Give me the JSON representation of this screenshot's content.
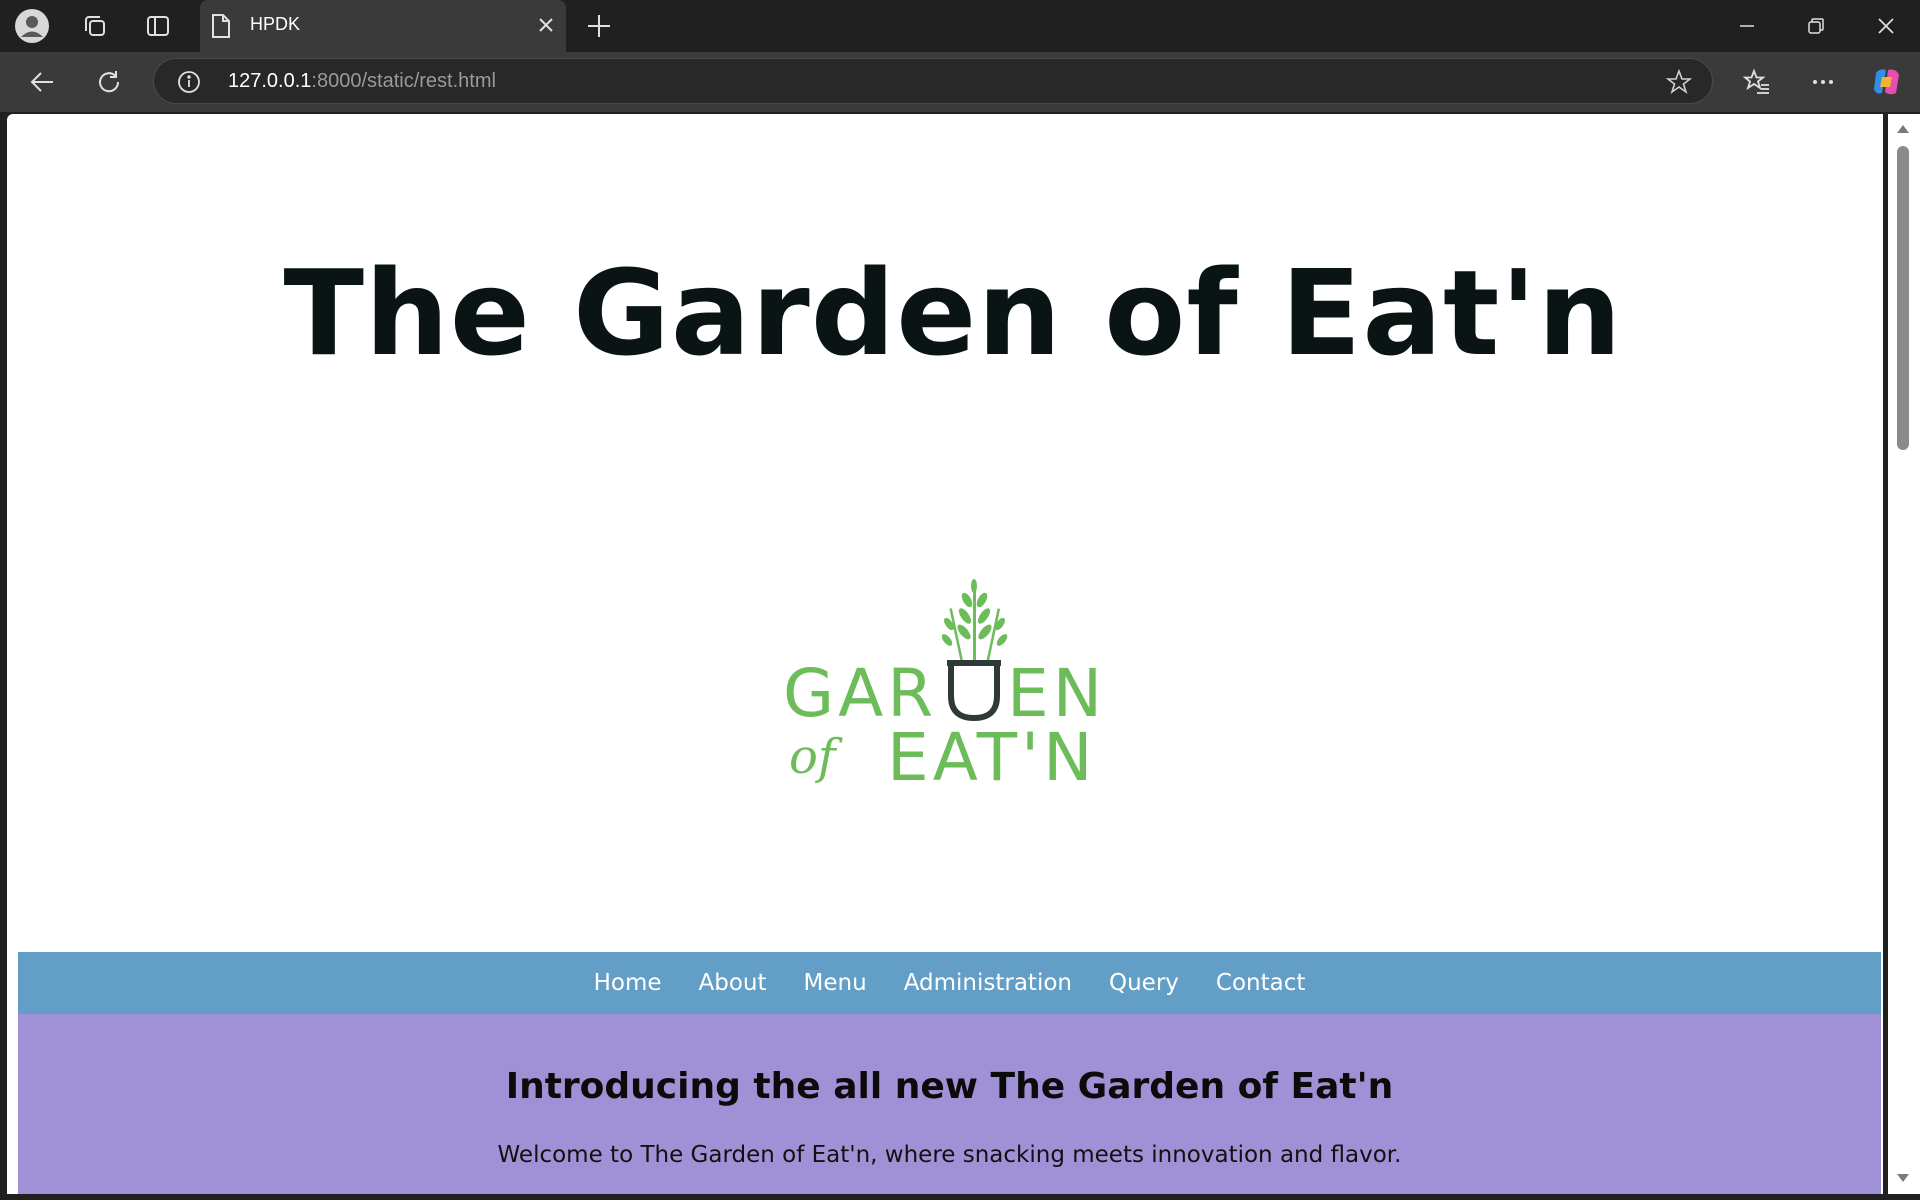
{
  "browser": {
    "tab_title": "HPDK",
    "url_host": "127.0.0.1",
    "url_rest": ":8000/static/rest.html"
  },
  "page": {
    "title": "The Garden of Eat'n",
    "logo_text": [
      "GARDEN",
      "of",
      "EAT'N"
    ],
    "nav": [
      "Home",
      "About",
      "Menu",
      "Administration",
      "Query",
      "Contact"
    ],
    "hero_heading": "Introducing the all new The Garden of Eat'n",
    "hero_text": "Welcome to The Garden of Eat'n, where snacking meets innovation and flavor."
  },
  "colors": {
    "nav_bar": "#639ec6",
    "hero_bg": "#a091d6",
    "logo_green": "#6cbc5a",
    "logo_dark": "#2e3a3a"
  }
}
